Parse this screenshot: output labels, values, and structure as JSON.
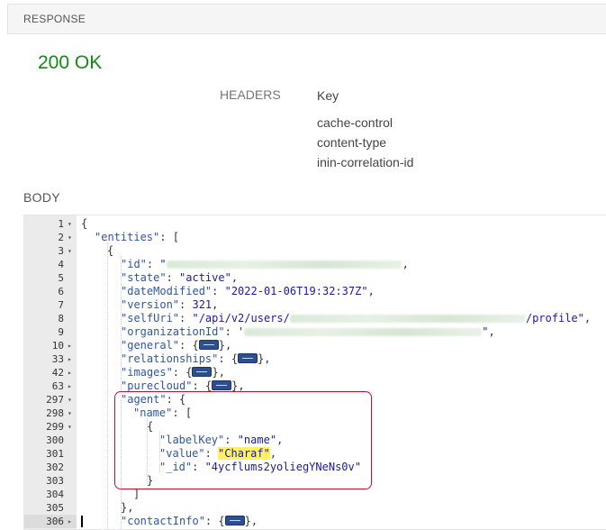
{
  "response": {
    "label": "RESPONSE",
    "status": "200 OK"
  },
  "headers": {
    "label": "HEADERS",
    "key_title": "Key",
    "keys": [
      "cache-control",
      "content-type",
      "inin-correlation-id"
    ]
  },
  "body": {
    "label": "BODY"
  },
  "editor": {
    "lines": [
      {
        "num": "1",
        "fold": "▾"
      },
      {
        "num": "2",
        "fold": "▾"
      },
      {
        "num": "3",
        "fold": "▾"
      },
      {
        "num": "4",
        "fold": ""
      },
      {
        "num": "5",
        "fold": ""
      },
      {
        "num": "6",
        "fold": ""
      },
      {
        "num": "7",
        "fold": ""
      },
      {
        "num": "8",
        "fold": ""
      },
      {
        "num": "9",
        "fold": ""
      },
      {
        "num": "10",
        "fold": "▸"
      },
      {
        "num": "33",
        "fold": "▸"
      },
      {
        "num": "42",
        "fold": "▸"
      },
      {
        "num": "63",
        "fold": "▸"
      },
      {
        "num": "297",
        "fold": "▾"
      },
      {
        "num": "298",
        "fold": "▾"
      },
      {
        "num": "299",
        "fold": "▾"
      },
      {
        "num": "300",
        "fold": ""
      },
      {
        "num": "301",
        "fold": ""
      },
      {
        "num": "302",
        "fold": ""
      },
      {
        "num": "303",
        "fold": ""
      },
      {
        "num": "304",
        "fold": ""
      },
      {
        "num": "305",
        "fold": ""
      },
      {
        "num": "306",
        "fold": "▸"
      }
    ],
    "tokens": {
      "open_brace": "{",
      "close_brace": "}",
      "close_brace_comma": "},",
      "open_bracket": "[",
      "close_bracket": "]",
      "comma": ",",
      "colon_space": ": ",
      "key_entities": "\"entities\"",
      "key_id": "\"id\"",
      "key_state": "\"state\"",
      "key_dateModified": "\"dateModified\"",
      "key_version": "\"version\"",
      "key_selfUri": "\"selfUri\"",
      "key_organizationId": "\"organizationId\"",
      "key_general": "\"general\"",
      "key_relationships": "\"relationships\"",
      "key_images": "\"images\"",
      "key_purecloud": "\"purecloud\"",
      "key_agent": "\"agent\"",
      "key_name": "\"name\"",
      "key_labelKey": "\"labelKey\"",
      "key_value": "\"value\"",
      "key__id": "\"_id\"",
      "key_contactInfo": "\"contactInfo\"",
      "val_id_start": "\"",
      "val_state": "\"active\"",
      "val_dateModified": "\"2022-01-06T19:32:37Z\"",
      "val_version": "321",
      "val_selfUri_start": "\"/api/v2/users/",
      "val_selfUri_end": "/profile\"",
      "val_org_start": "'",
      "val_org_end": "\"",
      "val_labelKey": "\"name\"",
      "val_value": "\"Charaf\"",
      "val__id": "\"4ycflums2yoliegYNeNs0v\""
    }
  },
  "colors": {
    "status_ok": "#138a13",
    "json_key": "#2f55a4",
    "json_string": "#1a1aa6",
    "search_highlight": "#fff25a",
    "annotation_box": "#c8102e"
  }
}
